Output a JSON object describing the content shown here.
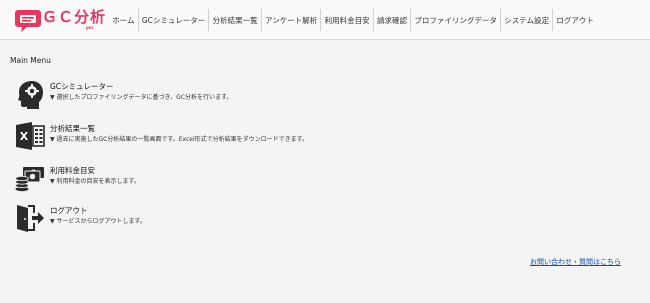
{
  "header": {
    "logo_text": "ＧＣ分析",
    "logo_sub": "pm",
    "nav": [
      {
        "label": "ホーム"
      },
      {
        "label": "GCシミュレーター"
      },
      {
        "label": "分析結果一覧"
      },
      {
        "label": "アンケート解析"
      },
      {
        "label": "利用料金目安"
      },
      {
        "label": "請求確認"
      },
      {
        "label": "プロファイリングデータ"
      },
      {
        "label": "システム設定"
      },
      {
        "label": "ログアウト"
      }
    ]
  },
  "main": {
    "section_title": "Main Menu",
    "items": [
      {
        "title": "GCシミュレーター",
        "desc": "▼ 選択したプロファイリングデータに基づき、GC分析を行います。",
        "icon": "head-gear-icon"
      },
      {
        "title": "分析結果一覧",
        "desc": "▼ 過去に実施したGC分析結果の一覧画面です。Excel形式で分析結果をダウンロードできます。",
        "icon": "excel-icon"
      },
      {
        "title": "利用料金目安",
        "desc": "▼ 利用料金の目安を表示します。",
        "icon": "money-icon"
      },
      {
        "title": "ログアウト",
        "desc": "▼ サービスからログアウトします。",
        "icon": "logout-icon"
      }
    ],
    "contact_link": "お問い合わせ・質問はこちら"
  },
  "colors": {
    "brand": "#e8365d",
    "link": "#1a4fa0",
    "icon": "#2b2b2b"
  }
}
